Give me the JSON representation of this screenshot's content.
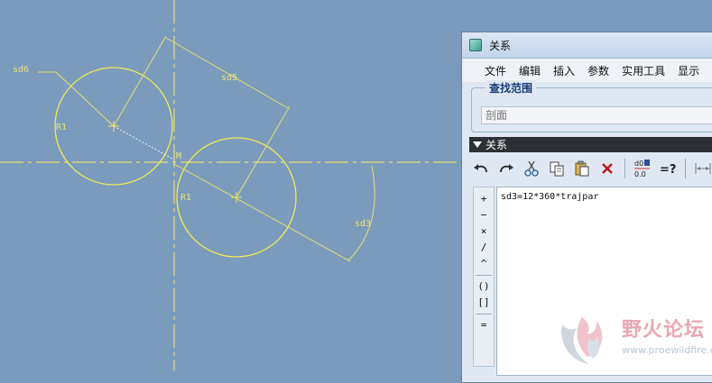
{
  "sketch": {
    "dimensions": {
      "sd6": "sd6",
      "sd5": "sd5",
      "sd3": "sd3",
      "r_upper": "R1",
      "r_lower": "R1",
      "m": "M"
    }
  },
  "window": {
    "title": "关系",
    "menu": [
      "文件",
      "编辑",
      "插入",
      "参数",
      "实用工具",
      "显示"
    ],
    "search": {
      "label": "查找范围",
      "placeholder": "剖面"
    },
    "section_label": "关系",
    "operators": [
      "+",
      "−",
      "×",
      "/",
      "^",
      "()",
      "[]",
      "="
    ],
    "relation_text": "sd3=12*360*trajpar"
  },
  "watermark": {
    "text": "野火论坛",
    "url": "www.proewildfire.cn"
  }
}
